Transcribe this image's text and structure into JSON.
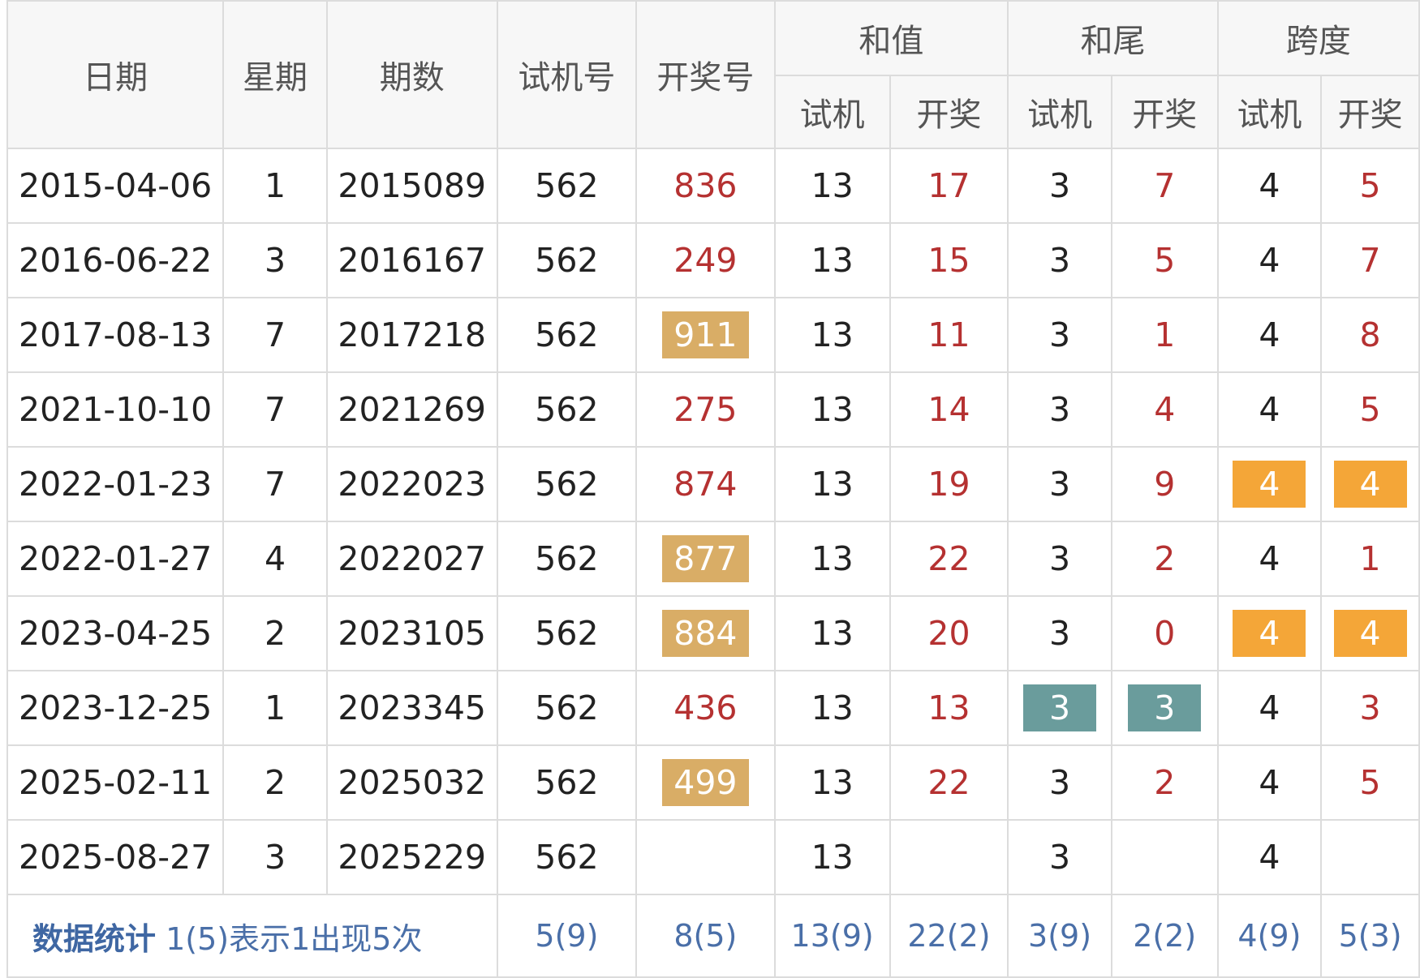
{
  "headers": {
    "date": "日期",
    "week": "星期",
    "issue": "期数",
    "trial": "试机号",
    "draw": "开奖号",
    "sum_group": "和值",
    "tail_group": "和尾",
    "span_group": "跨度",
    "sub_trial": "试机",
    "sub_draw": "开奖"
  },
  "rows": [
    {
      "date": "2015-04-06",
      "week": "1",
      "issue": "2015089",
      "trial": "562",
      "draw": "836",
      "draw_hl": false,
      "sum_t": "13",
      "sum_d": "17",
      "tail_t": "3",
      "tail_d": "7",
      "span_t": "4",
      "span_d": "5",
      "tail_hl": false,
      "span_hl": false
    },
    {
      "date": "2016-06-22",
      "week": "3",
      "issue": "2016167",
      "trial": "562",
      "draw": "249",
      "draw_hl": false,
      "sum_t": "13",
      "sum_d": "15",
      "tail_t": "3",
      "tail_d": "5",
      "span_t": "4",
      "span_d": "7",
      "tail_hl": false,
      "span_hl": false
    },
    {
      "date": "2017-08-13",
      "week": "7",
      "issue": "2017218",
      "trial": "562",
      "draw": "911",
      "draw_hl": true,
      "sum_t": "13",
      "sum_d": "11",
      "tail_t": "3",
      "tail_d": "1",
      "span_t": "4",
      "span_d": "8",
      "tail_hl": false,
      "span_hl": false
    },
    {
      "date": "2021-10-10",
      "week": "7",
      "issue": "2021269",
      "trial": "562",
      "draw": "275",
      "draw_hl": false,
      "sum_t": "13",
      "sum_d": "14",
      "tail_t": "3",
      "tail_d": "4",
      "span_t": "4",
      "span_d": "5",
      "tail_hl": false,
      "span_hl": false
    },
    {
      "date": "2022-01-23",
      "week": "7",
      "issue": "2022023",
      "trial": "562",
      "draw": "874",
      "draw_hl": false,
      "sum_t": "13",
      "sum_d": "19",
      "tail_t": "3",
      "tail_d": "9",
      "span_t": "4",
      "span_d": "4",
      "tail_hl": false,
      "span_hl": true
    },
    {
      "date": "2022-01-27",
      "week": "4",
      "issue": "2022027",
      "trial": "562",
      "draw": "877",
      "draw_hl": true,
      "sum_t": "13",
      "sum_d": "22",
      "tail_t": "3",
      "tail_d": "2",
      "span_t": "4",
      "span_d": "1",
      "tail_hl": false,
      "span_hl": false
    },
    {
      "date": "2023-04-25",
      "week": "2",
      "issue": "2023105",
      "trial": "562",
      "draw": "884",
      "draw_hl": true,
      "sum_t": "13",
      "sum_d": "20",
      "tail_t": "3",
      "tail_d": "0",
      "span_t": "4",
      "span_d": "4",
      "tail_hl": false,
      "span_hl": true
    },
    {
      "date": "2023-12-25",
      "week": "1",
      "issue": "2023345",
      "trial": "562",
      "draw": "436",
      "draw_hl": false,
      "sum_t": "13",
      "sum_d": "13",
      "tail_t": "3",
      "tail_d": "3",
      "span_t": "4",
      "span_d": "3",
      "tail_hl": true,
      "span_hl": false
    },
    {
      "date": "2025-02-11",
      "week": "2",
      "issue": "2025032",
      "trial": "562",
      "draw": "499",
      "draw_hl": true,
      "sum_t": "13",
      "sum_d": "22",
      "tail_t": "3",
      "tail_d": "2",
      "span_t": "4",
      "span_d": "5",
      "tail_hl": false,
      "span_hl": false
    },
    {
      "date": "2025-08-27",
      "week": "3",
      "issue": "2025229",
      "trial": "562",
      "draw": "",
      "draw_hl": false,
      "sum_t": "13",
      "sum_d": "",
      "tail_t": "3",
      "tail_d": "",
      "span_t": "4",
      "span_d": "",
      "tail_hl": false,
      "span_hl": false
    }
  ],
  "stats": {
    "label_strong": "数据统计",
    "label_rest": " 1(5)表示1出现5次",
    "trial": "5(9)",
    "draw": "8(5)",
    "sum_t": "13(9)",
    "sum_d": "22(2)",
    "tail_t": "3(9)",
    "tail_d": "2(2)",
    "span_t": "4(9)",
    "span_d": "5(3)"
  },
  "colors": {
    "draw_red": "#b53131",
    "draw_highlight": "#d9ad66",
    "span_highlight": "#f4a638",
    "tail_highlight": "#6a9c9c",
    "stats_blue": "#4a6fa8"
  }
}
